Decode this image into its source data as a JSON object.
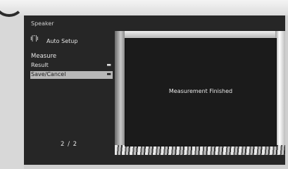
{
  "menu": {
    "title": "Speaker",
    "auto_setup_icon": "meter-icon",
    "auto_setup_label": "Auto Setup",
    "measure_label": "Measure",
    "items": [
      {
        "label": "Result",
        "icon": "folder-icon",
        "selected": false
      },
      {
        "label": "Save/Cancel",
        "icon": "folder-icon",
        "selected": true
      }
    ],
    "page_indicator": "2 / 2"
  },
  "panel": {
    "message": "Measurement Finished"
  }
}
